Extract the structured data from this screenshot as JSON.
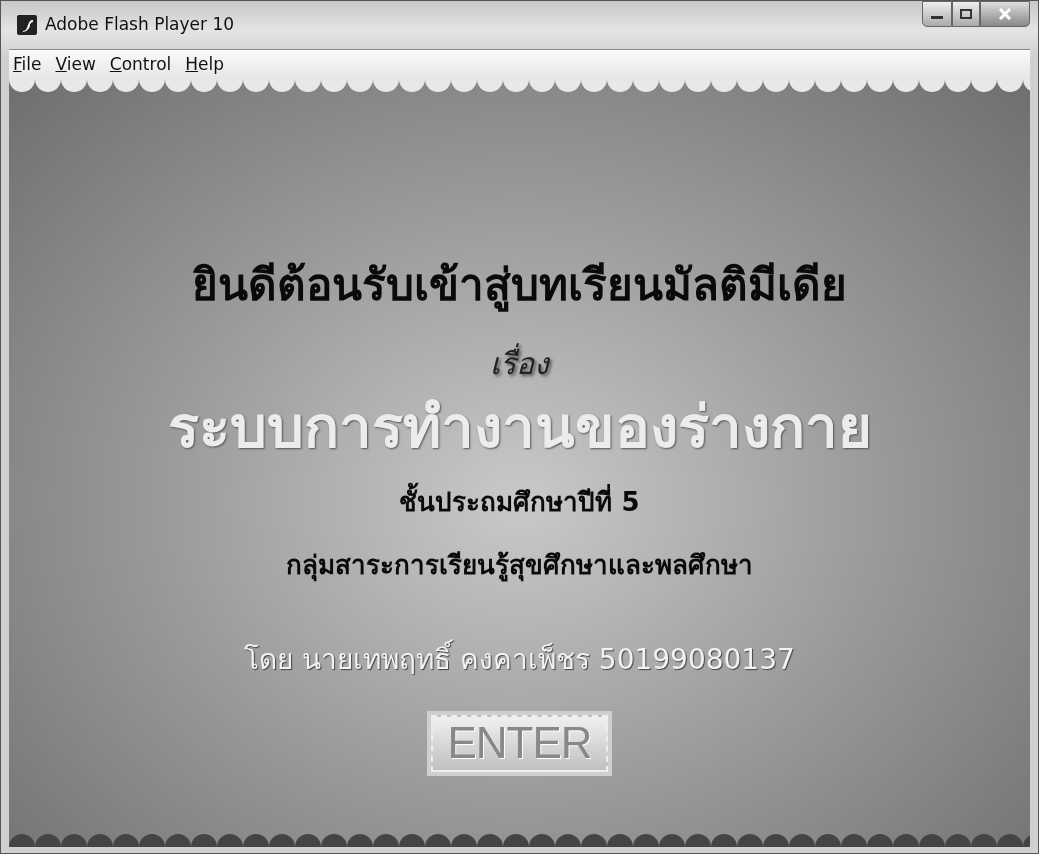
{
  "window": {
    "title": "Adobe Flash Player 10"
  },
  "menu": [
    "File",
    "View",
    "Control",
    "Help"
  ],
  "stage": {
    "heading": "ยินดีต้อนรับเข้าสู่บทเรียนมัลติมีเดีย",
    "subject_prefix": "เรื่อง",
    "subject": "ระบบการทำงานของร่างกาย",
    "grade": "ชั้นประถมศึกษาปีที่ 5",
    "group": "กลุ่มสาระการเรียนรู้สุขศึกษาและพลศึกษา",
    "author": "โดย นายเทพฤทธิ์  คงคาเพ็ชร 50199080137",
    "button": "ENTER"
  }
}
